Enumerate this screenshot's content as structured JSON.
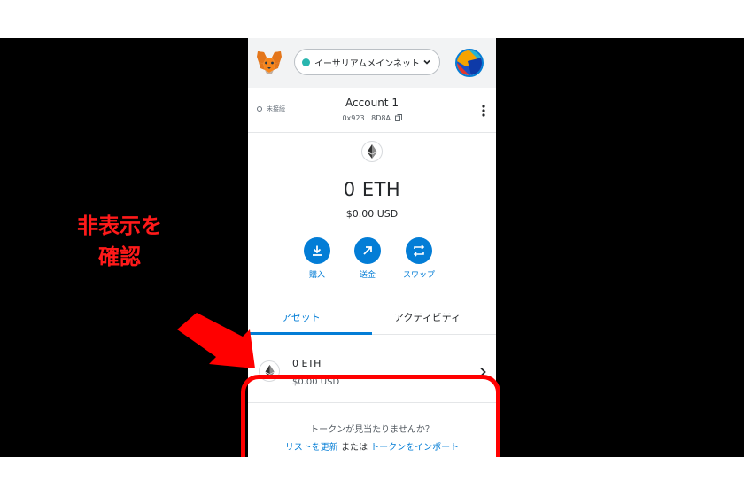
{
  "header": {
    "network_label": "イーサリアムメインネット",
    "icons": [
      "metamask-fox-icon",
      "chevron-down-icon",
      "account-avatar"
    ]
  },
  "account": {
    "connection_status": "未接続",
    "name": "Account 1",
    "address": "0x923...8D8A",
    "icons": [
      "copy-icon",
      "kebab-menu-icon"
    ]
  },
  "balance": {
    "amount": "0 ETH",
    "usd": "$0.00 USD"
  },
  "actions": {
    "buy": "購入",
    "send": "送金",
    "swap": "スワップ"
  },
  "tabs": {
    "assets": "アセット",
    "activity": "アクティビティ"
  },
  "asset_list": [
    {
      "amount": "0 ETH",
      "usd": "$0.00 USD"
    }
  ],
  "footer": {
    "missing_tokens": "トークンが見当たりませんか？",
    "refresh_list": "リストを更新",
    "or": "または",
    "import_tokens": "トークンをインポート"
  },
  "annotation": {
    "line1": "非表示を",
    "line2": "確認"
  },
  "colors": {
    "accent": "#037dd6",
    "annotation": "#ff0000",
    "network_dot": "#29b6af",
    "topbar_bg": "#f2f3f4"
  }
}
